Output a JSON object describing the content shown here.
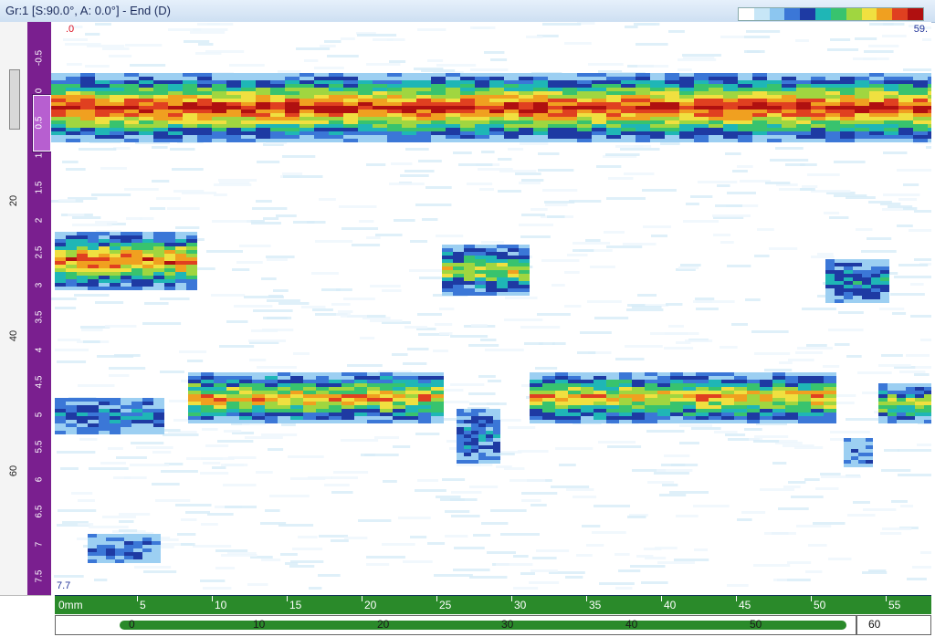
{
  "titlebar": {
    "title": "Gr:1 [S:90.0°, A: 0.0°] - End (D)"
  },
  "palette": {
    "colors": [
      "#ffffff",
      "#c7e6f7",
      "#8cc6f0",
      "#3b77d7",
      "#1e3aa3",
      "#1fb6b6",
      "#38c36e",
      "#a0d640",
      "#f0e040",
      "#f0a020",
      "#e04020",
      "#b01010"
    ]
  },
  "plot": {
    "top_left_value": ".0",
    "top_right_value": "59.",
    "bottom_left_value": "7.7"
  },
  "vertical_ruler": {
    "ticks": [
      "-0.5",
      "0",
      "0.5",
      "1",
      "1.5",
      "2",
      "2.5",
      "3",
      "3.5",
      "4",
      "4.5",
      "5",
      "5.5",
      "6",
      "6.5",
      "7",
      "7.5"
    ]
  },
  "left_axis": {
    "ticks": [
      "20",
      "40",
      "60"
    ]
  },
  "horizontal_ruler": {
    "unit_label": "0mm",
    "ticks": [
      "5",
      "10",
      "15",
      "20",
      "25",
      "30",
      "35",
      "40",
      "45",
      "50",
      "55"
    ]
  },
  "scrollbar": {
    "ticks": [
      "0",
      "10",
      "20",
      "30",
      "40",
      "50"
    ],
    "end_value": "60"
  }
}
